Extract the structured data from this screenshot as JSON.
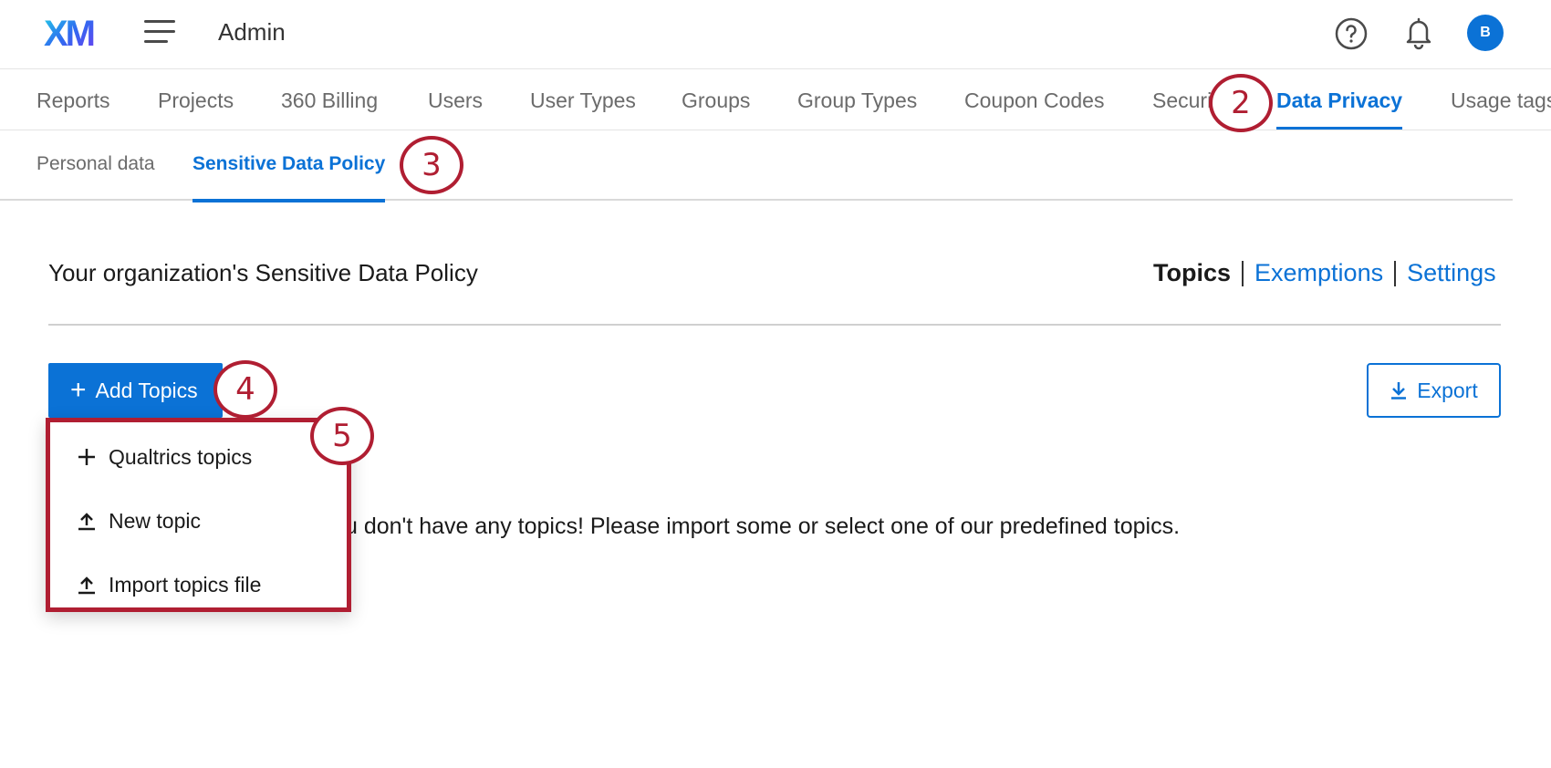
{
  "header": {
    "logo_text": "XM",
    "app_title": "Admin",
    "avatar_initial": "B"
  },
  "tabs": [
    {
      "label": "Reports"
    },
    {
      "label": "Projects"
    },
    {
      "label": "360 Billing"
    },
    {
      "label": "Users"
    },
    {
      "label": "User Types"
    },
    {
      "label": "Groups"
    },
    {
      "label": "Group Types"
    },
    {
      "label": "Coupon Codes"
    },
    {
      "label": "Securi"
    },
    {
      "label": "Data Privacy"
    },
    {
      "label": "Usage tags"
    }
  ],
  "active_tab": "Data Privacy",
  "subtabs": [
    {
      "label": "Personal data"
    },
    {
      "label": "Sensitive Data Policy"
    }
  ],
  "active_subtab": "Sensitive Data Policy",
  "callouts": {
    "c2": "2",
    "c3": "3",
    "c4": "4",
    "c5": "5"
  },
  "section": {
    "title": "Your organization's Sensitive Data Policy",
    "links": [
      {
        "label": "Topics"
      },
      {
        "label": "Exemptions"
      },
      {
        "label": "Settings"
      }
    ],
    "current_link": "Topics"
  },
  "buttons": {
    "add_topics": "Add Topics",
    "export": "Export"
  },
  "dropdown": {
    "items": [
      {
        "label": "Qualtrics topics",
        "icon": "plus-icon"
      },
      {
        "label": "New topic",
        "icon": "upload-icon"
      },
      {
        "label": "Import topics file",
        "icon": "upload-icon"
      }
    ]
  },
  "empty_message": "u don't have any topics! Please import some or select one of our predefined topics.",
  "colors": {
    "accent": "#0b72d6",
    "callout": "#b01e32"
  }
}
